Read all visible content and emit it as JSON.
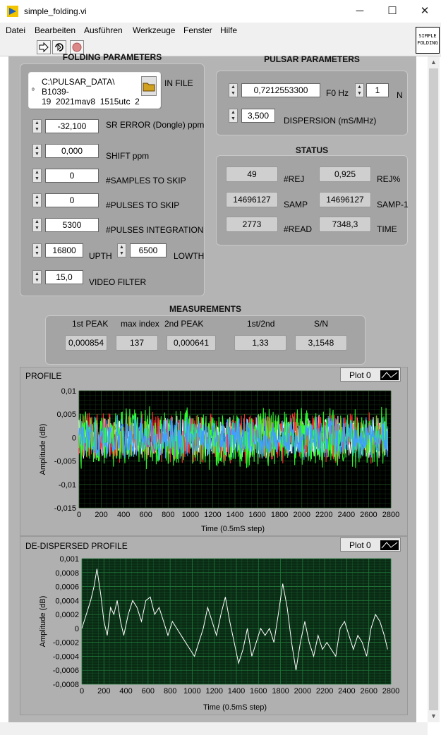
{
  "window": {
    "title": "simple_folding.vi"
  },
  "menu": [
    "Datei",
    "Bearbeiten",
    "Ausführen",
    "Werkzeuge",
    "Fenster",
    "Hilfe"
  ],
  "vi_icon": {
    "line1": "SIMPLE",
    "line2": "FOLDING"
  },
  "folding": {
    "title": "FOLDING PARAMETERS",
    "infile_label": "IN FILE",
    "infile_lines": [
      "C:\\PULSAR_DATA\\",
      "B1039-",
      "19_2021may8_1515utc_2"
    ],
    "sr_error": {
      "label": "SR ERROR (Dongle) ppm",
      "value": "-32,100"
    },
    "shift": {
      "label": "SHIFT ppm",
      "value": "0,000"
    },
    "samples_skip": {
      "label": "#SAMPLES TO SKIP",
      "value": "0"
    },
    "pulses_skip": {
      "label": "#PULSES TO SKIP",
      "value": "0"
    },
    "pulses_int": {
      "label": "#PULSES INTEGRATION",
      "value": "5300"
    },
    "upth": {
      "label": "UPTH",
      "value": "16800"
    },
    "lowth": {
      "label": "LOWTH",
      "value": "6500"
    },
    "video": {
      "label": "VIDEO FILTER",
      "value": "15,0"
    }
  },
  "pulsar": {
    "title": "PULSAR PARAMETERS",
    "f0": {
      "label": "F0 Hz",
      "value": "0,7212553300"
    },
    "n": {
      "label": "N",
      "value": "1"
    },
    "dispersion": {
      "label": "DISPERSION (mS/MHz)",
      "value": "3,500"
    }
  },
  "status": {
    "title": "STATUS",
    "rej": {
      "label": "#REJ",
      "value": "49"
    },
    "rej_pct": {
      "label": "REJ%",
      "value": "0,925"
    },
    "samp": {
      "label": "SAMP",
      "value": "14696127"
    },
    "samp1": {
      "label": "SAMP-1",
      "value": "14696127"
    },
    "read": {
      "label": "#READ",
      "value": "2773"
    },
    "time": {
      "label": "TIME",
      "value": "7348,3"
    }
  },
  "measurements": {
    "title": "MEASUREMENTS",
    "first_peak": {
      "label": "1st PEAK",
      "value": "0,000854"
    },
    "max_index": {
      "label": "max index",
      "value": "137"
    },
    "second_peak": {
      "label": "2nd PEAK",
      "value": "0,000641"
    },
    "ratio": {
      "label": "1st/2nd",
      "value": "1,33"
    },
    "sn": {
      "label": "S/N",
      "value": "3,1548"
    }
  },
  "chart_data": [
    {
      "type": "line",
      "title": "PROFILE",
      "legend": "Plot 0",
      "xlabel": "Time (0.5mS step)",
      "ylabel": "Amplitude (dB)",
      "xlim": [
        0,
        2800
      ],
      "ylim": [
        -0.015,
        0.01
      ],
      "xticks": [
        "0",
        "200",
        "400",
        "600",
        "800",
        "1000",
        "1200",
        "1400",
        "1600",
        "1800",
        "2000",
        "2200",
        "2400",
        "2600",
        "2800"
      ],
      "yticks": [
        "0,01",
        "0,005",
        "0",
        "-0,005",
        "-0,01",
        "-0,015"
      ],
      "series": [
        {
          "color": "#ffffff",
          "noise_amplitude": 0.005
        },
        {
          "color": "#ff3030",
          "noise_amplitude": 0.006
        },
        {
          "color": "#30ff30",
          "noise_amplitude": 0.007
        },
        {
          "color": "#40a0ff",
          "noise_amplitude": 0.005
        }
      ]
    },
    {
      "type": "line",
      "title": "DE-DISPERSED PROFILE",
      "legend": "Plot 0",
      "xlabel": "Time (0.5mS step)",
      "ylabel": "Amplitude (dB)",
      "xlim": [
        0,
        2800
      ],
      "ylim": [
        -0.0008,
        0.001
      ],
      "xticks": [
        "0",
        "200",
        "400",
        "600",
        "800",
        "1000",
        "1200",
        "1400",
        "1600",
        "1800",
        "2000",
        "2200",
        "2400",
        "2600",
        "2800"
      ],
      "yticks": [
        "0,001",
        "0,0008",
        "0,0006",
        "0,0004",
        "0,0002",
        "0",
        "-0,0002",
        "-0,0004",
        "-0,0006",
        "-0,0008"
      ],
      "series": [
        {
          "color": "#ffffff",
          "x": [
            0,
            40,
            80,
            110,
            137,
            170,
            200,
            230,
            260,
            290,
            320,
            350,
            380,
            420,
            460,
            500,
            540,
            580,
            620,
            660,
            700,
            740,
            780,
            820,
            860,
            900,
            940,
            980,
            1020,
            1060,
            1100,
            1140,
            1180,
            1220,
            1260,
            1300,
            1340,
            1380,
            1420,
            1460,
            1500,
            1540,
            1580,
            1620,
            1660,
            1700,
            1740,
            1780,
            1820,
            1860,
            1900,
            1940,
            1980,
            2020,
            2060,
            2100,
            2140,
            2180,
            2220,
            2260,
            2300,
            2340,
            2380,
            2420,
            2460,
            2500,
            2540,
            2580,
            2620,
            2660,
            2700,
            2740,
            2770
          ],
          "y": [
            0.0,
            0.0002,
            0.0004,
            0.0006,
            0.000854,
            0.0005,
            0.0001,
            -0.0001,
            0.0003,
            0.0002,
            0.0004,
            0.0001,
            -0.0001,
            0.0002,
            0.0004,
            0.0003,
            0.0001,
            0.0004,
            0.00045,
            0.0002,
            0.0003,
            0.0001,
            -0.0001,
            0.0001,
            0.0,
            -0.0001,
            -0.0002,
            -0.0003,
            -0.0004,
            -0.0002,
            0.0,
            0.0003,
            0.0001,
            -0.0001,
            0.0002,
            0.00045,
            0.0001,
            -0.0002,
            -0.0005,
            -0.0003,
            0.0,
            -0.0004,
            -0.0002,
            0.0,
            -0.0001,
            0.0,
            -0.0002,
            0.0002,
            0.000641,
            0.0003,
            -0.0002,
            -0.0006,
            -0.0002,
            0.0001,
            -0.0002,
            -0.0004,
            -0.0001,
            -0.0003,
            -0.0002,
            -0.0003,
            -0.0004,
            0.0,
            0.0001,
            -0.0001,
            -0.0003,
            -0.0001,
            -0.0002,
            -0.0004,
            0.0,
            0.0002,
            0.0001,
            -0.0001,
            -0.0003
          ]
        }
      ]
    }
  ]
}
